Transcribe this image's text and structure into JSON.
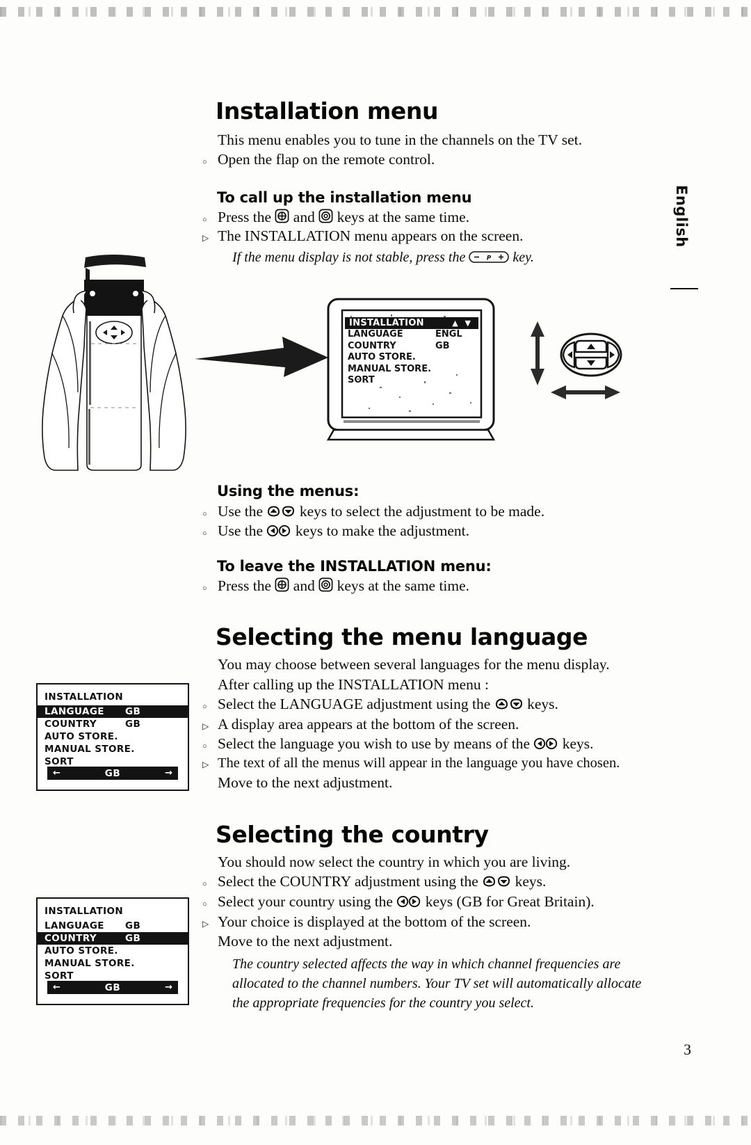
{
  "page": {
    "number": "3",
    "language_tab": "English"
  },
  "sections": {
    "installation": {
      "title": "Installation menu",
      "intro": "This menu enables you to tune in the channels on the TV set.",
      "intro_bullet": "Open the flap on the remote control.",
      "call_up": {
        "heading": "To call up the installation menu",
        "step1_a": "Press the",
        "step1_b": "and",
        "step1_c": "keys at the same time.",
        "step2": "The INSTALLATION menu appears on the screen.",
        "note_a": "If the menu display is not stable, press the",
        "note_b": "key."
      },
      "using": {
        "heading": "Using the menus:",
        "line1_a": "Use the",
        "line1_b": "keys to select the adjustment to be made.",
        "line2_a": "Use the",
        "line2_b": "keys to make the adjustment."
      },
      "leave": {
        "heading": "To leave the INSTALLATION menu:",
        "step_a": "Press the",
        "step_b": "and",
        "step_c": "keys at the same time."
      }
    },
    "language": {
      "title": "Selecting the menu language",
      "line1": "You may choose between several languages for the menu display.",
      "line2": "After calling up the INSTALLATION menu :",
      "b1_a": "Select the LANGUAGE adjustment using the",
      "b1_b": "keys.",
      "b2": "A display area appears at the bottom of the screen.",
      "b3_a": "Select the language you wish to use by means of the",
      "b3_b": "keys.",
      "b4": "The text of all the menus will appear in the language you have chosen.",
      "b5": "Move to the next adjustment."
    },
    "country": {
      "title": "Selecting the country",
      "line1": "You should now select the country in which you are living.",
      "b1_a": "Select the COUNTRY adjustment using the",
      "b1_b": "keys.",
      "b2_a": "Select your country using the",
      "b2_b": "keys (GB for Great Britain).",
      "b3": "Your choice is displayed at the bottom of the screen.",
      "b4": "Move to the next adjustment.",
      "note_l1": "The country selected affects the way in which channel frequencies are",
      "note_l2": "allocated to the channel numbers. Your TV set will automatically allocate",
      "note_l3": "the appropriate frequencies for the country you select."
    }
  },
  "osd_tv": {
    "title": "INSTALLATION",
    "items": [
      {
        "label": "LANGUAGE",
        "value": "ENGL"
      },
      {
        "label": "COUNTRY",
        "value": "GB"
      },
      {
        "label": "AUTO STORE.",
        "value": ""
      },
      {
        "label": "MANUAL STORE.",
        "value": ""
      },
      {
        "label": "SORT",
        "value": ""
      }
    ]
  },
  "osd_language": {
    "title": "INSTALLATION",
    "items": [
      {
        "label": "LANGUAGE",
        "value": "GB",
        "highlighted": true
      },
      {
        "label": "COUNTRY",
        "value": "GB",
        "highlighted": false
      },
      {
        "label": "AUTO STORE.",
        "value": "",
        "highlighted": false
      },
      {
        "label": "MANUAL STORE.",
        "value": "",
        "highlighted": false
      },
      {
        "label": "SORT",
        "value": "",
        "highlighted": false
      }
    ],
    "bar": {
      "left": "←",
      "center": "GB",
      "right": "→"
    }
  },
  "osd_country": {
    "title": "INSTALLATION",
    "items": [
      {
        "label": "LANGUAGE",
        "value": "GB",
        "highlighted": false
      },
      {
        "label": "COUNTRY",
        "value": "GB",
        "highlighted": true
      },
      {
        "label": "AUTO STORE.",
        "value": "",
        "highlighted": false
      },
      {
        "label": "MANUAL STORE.",
        "value": "",
        "highlighted": false
      },
      {
        "label": "SORT",
        "value": "",
        "highlighted": false
      }
    ],
    "bar": {
      "left": "←",
      "center": "GB",
      "right": "→"
    }
  },
  "keys": {
    "menu_key": "⊕",
    "status_key": "⊚",
    "program_key": "- P +",
    "up_down": "▲ ▼",
    "left_right": "◀ ▶"
  },
  "colors": {
    "ink": "#0d0d0d",
    "paper": "#fdfdfb",
    "osd_highlight": "#131313"
  }
}
